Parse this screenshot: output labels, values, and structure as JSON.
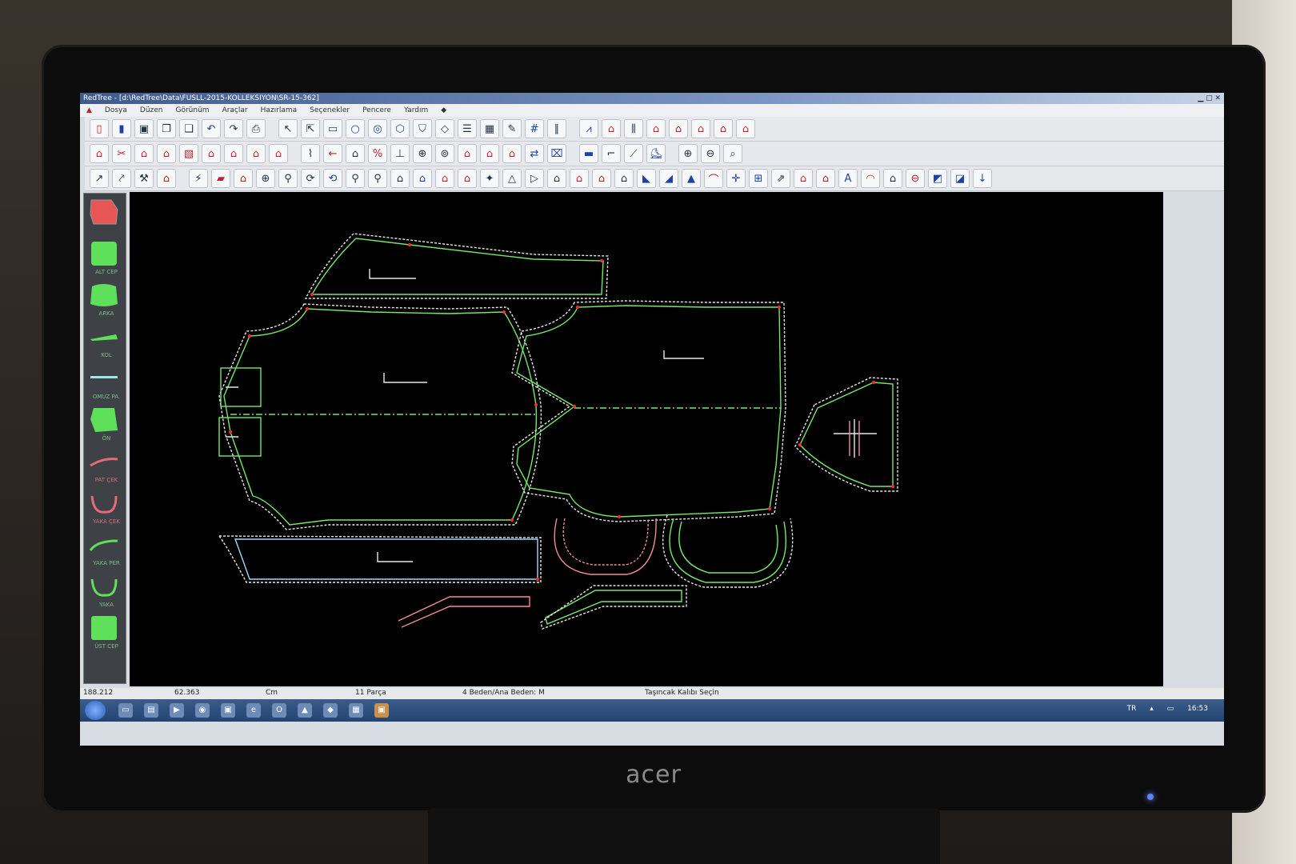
{
  "window": {
    "title": "RedTree - [d:\\RedTree\\Data\\FUSLL-2015-KOLLEKSIYON\\SR-15-362]"
  },
  "menu": [
    "Dosya",
    "Düzen",
    "Görünüm",
    "Araçlar",
    "Hazırlama",
    "Seçenekler",
    "Pencere",
    "Yardım"
  ],
  "sidebar": {
    "pieces": [
      {
        "label": ""
      },
      {
        "label": "ALT CEP"
      },
      {
        "label": "ARKA"
      },
      {
        "label": "KOL"
      },
      {
        "label": "OMUZ PA."
      },
      {
        "label": "ÖN"
      },
      {
        "label": "PAT ÇEK"
      },
      {
        "label": "YAKA ÇEK"
      },
      {
        "label": "YAKA PER"
      },
      {
        "label": "YAKA"
      },
      {
        "label": "ÜST CEP"
      }
    ]
  },
  "status": {
    "x": "188.212",
    "y": "62.363",
    "unit": "Cm",
    "pieces": "11 Parça",
    "size": "4 Beden/Ana Beden: M",
    "hint": "Taşıncak Kalıbı Seçin"
  },
  "taskbar": {
    "lang": "TR",
    "time": "16:53"
  },
  "monitor": {
    "brand": "acer"
  },
  "colors": {
    "pattern_green": "#74e86a",
    "pattern_pink": "#f08aa0",
    "pattern_white": "#e8e8e8",
    "point_red": "#ff2a2a"
  }
}
